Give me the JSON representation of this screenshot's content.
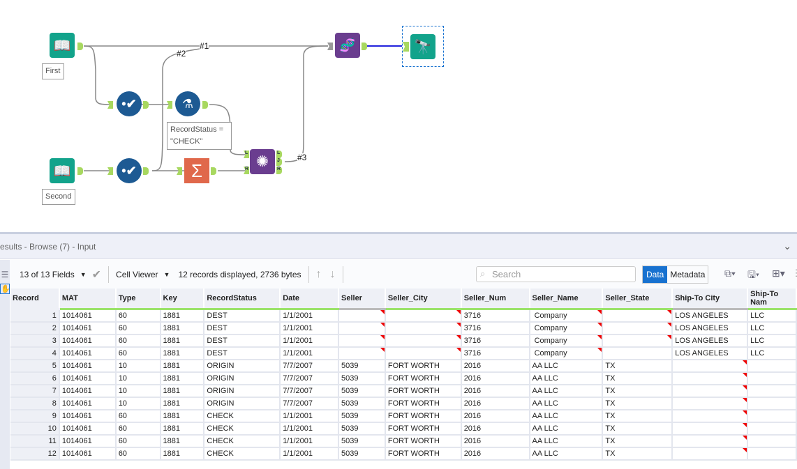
{
  "workflow": {
    "labels": {
      "first": "First",
      "second": "Second",
      "filter_expr": "RecordStatus =\n\"CHECK\""
    },
    "wire_labels": [
      "#1",
      "#2",
      "#3"
    ],
    "join_anchors": {
      "in_left": "L",
      "in_right": "R",
      "out_left": "L",
      "out_join": "J",
      "out_right": "R"
    }
  },
  "results": {
    "title": "esults - Browse (7) - Input",
    "fields_selector": "13 of 13 Fields",
    "cell_viewer": "Cell Viewer",
    "status": "12 records displayed, 2736 bytes",
    "search_placeholder": "Search",
    "tab_data": "Data",
    "tab_metadata": "Metadata",
    "columns": [
      "Record",
      "MAT",
      "Type",
      "Key",
      "RecordStatus",
      "Date",
      "Seller",
      "Seller_City",
      "Seller_Num",
      "Seller_Name",
      "Seller_State",
      "Ship-To City",
      "Ship-To Nam"
    ],
    "rows": [
      [
        "1",
        "1014061",
        "60",
        "1881",
        "DEST",
        "1/1/2001",
        "",
        "",
        "3716",
        " Company",
        "",
        "LOS ANGELES",
        "LLC"
      ],
      [
        "2",
        "1014061",
        "60",
        "1881",
        "DEST",
        "1/1/2001",
        "",
        "",
        "3716",
        " Company",
        "",
        "LOS ANGELES",
        "LLC"
      ],
      [
        "3",
        "1014061",
        "60",
        "1881",
        "DEST",
        "1/1/2001",
        "",
        "",
        "3716",
        " Company",
        "",
        "LOS ANGELES",
        "LLC"
      ],
      [
        "4",
        "1014061",
        "60",
        "1881",
        "DEST",
        "1/1/2001",
        "",
        "",
        "3716",
        " Company",
        "",
        "LOS ANGELES",
        "LLC"
      ],
      [
        "5",
        "1014061",
        "10",
        "1881",
        "ORIGIN",
        "7/7/2007",
        "5039",
        "FORT WORTH",
        "2016",
        "AA LLC",
        "TX",
        "",
        ""
      ],
      [
        "6",
        "1014061",
        "10",
        "1881",
        "ORIGIN",
        "7/7/2007",
        "5039",
        "FORT WORTH",
        "2016",
        "AA LLC",
        "TX",
        "",
        ""
      ],
      [
        "7",
        "1014061",
        "10",
        "1881",
        "ORIGIN",
        "7/7/2007",
        "5039",
        "FORT WORTH",
        "2016",
        "AA LLC",
        "TX",
        "",
        ""
      ],
      [
        "8",
        "1014061",
        "10",
        "1881",
        "ORIGIN",
        "7/7/2007",
        "5039",
        "FORT WORTH",
        "2016",
        "AA LLC",
        "TX",
        "",
        ""
      ],
      [
        "9",
        "1014061",
        "60",
        "1881",
        "CHECK",
        "1/1/2001",
        "5039",
        "FORT WORTH",
        "2016",
        "AA LLC",
        "TX",
        "",
        ""
      ],
      [
        "10",
        "1014061",
        "60",
        "1881",
        "CHECK",
        "1/1/2001",
        "5039",
        "FORT WORTH",
        "2016",
        "AA LLC",
        "TX",
        "",
        ""
      ],
      [
        "11",
        "1014061",
        "60",
        "1881",
        "CHECK",
        "1/1/2001",
        "5039",
        "FORT WORTH",
        "2016",
        "AA LLC",
        "TX",
        "",
        ""
      ],
      [
        "12",
        "1014061",
        "60",
        "1881",
        "CHECK",
        "1/1/2001",
        "5039",
        "FORT WORTH",
        "2016",
        "AA LLC",
        "TX",
        "",
        ""
      ]
    ],
    "null_markers": [
      [
        6,
        7,
        9,
        10
      ],
      [
        6,
        7,
        9,
        10
      ],
      [
        6,
        7,
        9,
        10
      ],
      [
        6,
        7,
        9
      ],
      [
        11
      ],
      [
        11
      ],
      [
        11
      ],
      [
        11
      ],
      [
        11
      ],
      [
        11
      ],
      [
        11
      ],
      [
        11
      ]
    ]
  }
}
